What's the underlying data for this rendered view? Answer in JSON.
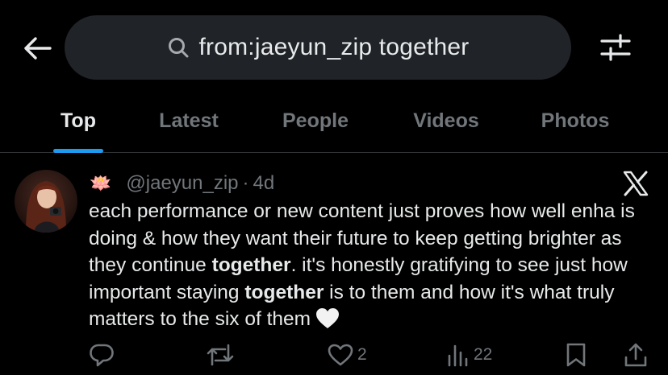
{
  "search": {
    "query": "from:jaeyun_zip together"
  },
  "tabs": [
    {
      "label": "Top",
      "active": true
    },
    {
      "label": "Latest",
      "active": false
    },
    {
      "label": "People",
      "active": false
    },
    {
      "label": "Videos",
      "active": false
    },
    {
      "label": "Photos",
      "active": false
    }
  ],
  "post": {
    "emoji": "🪷",
    "handle": "@jaeyun_zip",
    "separator": "·",
    "time": "4d",
    "text": {
      "seg1": "each performance or new content just proves how well enha is doing & how they want their future to keep getting brighter as they continue ",
      "bold1": "together",
      "seg2": ". it's honestly gratifying to see just how important staying ",
      "bold2": "together",
      "seg3": " is to them and how it's what truly matters to the six of them"
    },
    "stats": {
      "replies": "",
      "reposts": "",
      "likes": "2",
      "views": "22"
    }
  },
  "colors": {
    "background": "#000000",
    "accent": "#1d9bf0",
    "muted": "#71767b",
    "text": "#e7e9ea",
    "search_bg": "#202327"
  }
}
